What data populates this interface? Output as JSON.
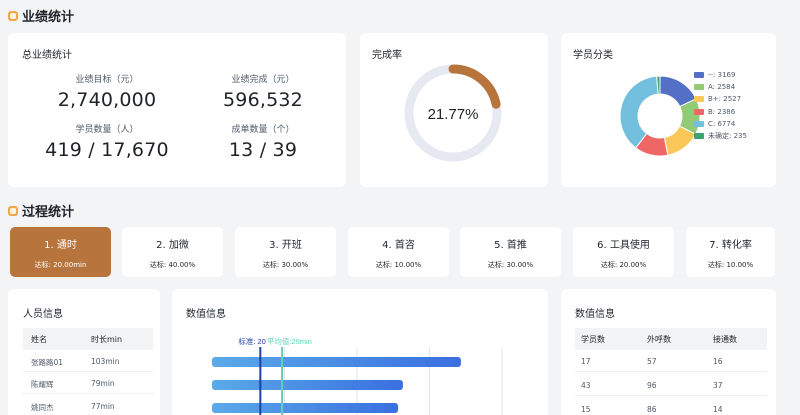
{
  "sections": {
    "performance": "业绩统计",
    "process": "过程统计"
  },
  "summary": {
    "title": "总业绩统计",
    "stats": [
      {
        "label": "业绩目标（元）",
        "value": "2,740,000"
      },
      {
        "label": "业绩完成（元）",
        "value": "596,532"
      },
      {
        "label": "学员数量（人）",
        "value": "419 / 17,670"
      },
      {
        "label": "成单数量（个）",
        "value": "13 / 39"
      }
    ]
  },
  "completion": {
    "title": "完成率",
    "value_label": "21.77%",
    "percent": 21.77,
    "colors": {
      "fill": "#b8743d",
      "track": "#e6e9f2"
    }
  },
  "student_category": {
    "title": "学员分类",
    "chart_data": {
      "type": "pie",
      "title": "",
      "slices": [
        {
          "label": "--: 3169",
          "value": 3169,
          "color": "#5470c6"
        },
        {
          "label": "A: 2584",
          "value": 2584,
          "color": "#91cc75"
        },
        {
          "label": "B+: 2527",
          "value": 2527,
          "color": "#fac858"
        },
        {
          "label": "B: 2386",
          "value": 2386,
          "color": "#ee6666"
        },
        {
          "label": "C: 6774",
          "value": 6774,
          "color": "#73c0de"
        },
        {
          "label": "未确定: 235",
          "value": 235,
          "color": "#3ba272"
        }
      ],
      "legend_position": "right"
    }
  },
  "process_items": [
    {
      "name": "1. 通时",
      "target": "达标: 20.00min",
      "active": true
    },
    {
      "name": "2. 加微",
      "target": "达标: 40.00%",
      "active": false
    },
    {
      "name": "3. 开班",
      "target": "达标: 30.00%",
      "active": false
    },
    {
      "name": "4. 首咨",
      "target": "达标: 10.00%",
      "active": false
    },
    {
      "name": "5. 首推",
      "target": "达标: 30.00%",
      "active": false
    },
    {
      "name": "6. 工具使用",
      "target": "达标: 20.00%",
      "active": false
    },
    {
      "name": "7. 转化率",
      "target": "达标: 10.00%",
      "active": false
    }
  ],
  "people_info": {
    "title": "人员信息",
    "columns": [
      "姓名",
      "时长min"
    ],
    "rows": [
      [
        "张路路01",
        "103min"
      ],
      [
        "陈耀辉",
        "79min"
      ],
      [
        "姚同杰",
        "77min"
      ]
    ]
  },
  "value_chart": {
    "title": "数值信息",
    "chart_data": {
      "type": "bar",
      "orientation": "horizontal",
      "values": [
        103,
        79,
        77
      ],
      "reference_lines": [
        {
          "label": "标准: 20",
          "value": 20,
          "color": "#1f3fa8"
        },
        {
          "label": "平均值:29min",
          "value": 29,
          "color": "#5fd3b0"
        }
      ],
      "xlim": [
        0,
        120
      ],
      "grid": true
    },
    "bar_color_start": "#5aaae8",
    "bar_color_end": "#3a6fe0"
  },
  "value_table": {
    "title": "数值信息",
    "columns": [
      "学员数",
      "外呼数",
      "接通数"
    ],
    "rows": [
      [
        "17",
        "57",
        "16"
      ],
      [
        "43",
        "96",
        "37"
      ],
      [
        "15",
        "86",
        "14"
      ]
    ]
  }
}
